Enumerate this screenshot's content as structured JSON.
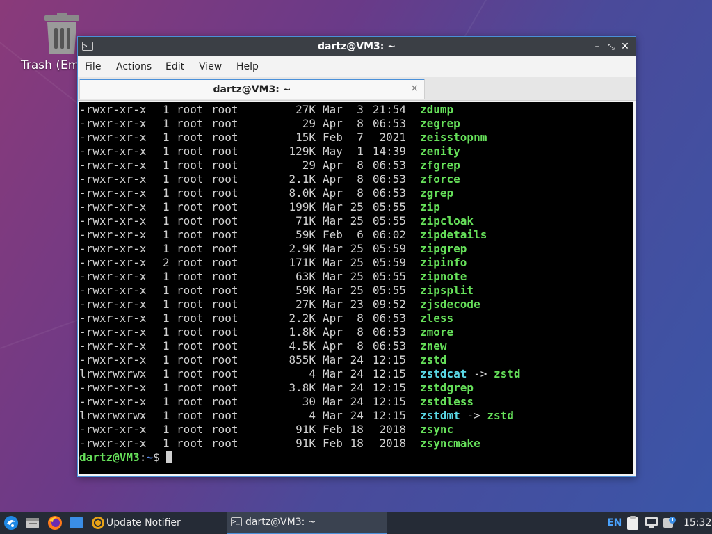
{
  "desktop": {
    "trash_label": "Trash (Em"
  },
  "window": {
    "title": "dartz@VM3: ~",
    "controls": [
      "minimize",
      "maximize",
      "close"
    ],
    "menu": [
      "File",
      "Actions",
      "Edit",
      "View",
      "Help"
    ],
    "tab": {
      "label": "dartz@VM3: ~",
      "close": "×"
    }
  },
  "terminal": {
    "rows": [
      {
        "perm": "-rwxr-xr-x",
        "links": "1",
        "owner": "root",
        "group": "root",
        "size": "27K",
        "month": "Mar",
        "day": "3",
        "time": "21:54",
        "name": "zdump"
      },
      {
        "perm": "-rwxr-xr-x",
        "links": "1",
        "owner": "root",
        "group": "root",
        "size": "29",
        "month": "Apr",
        "day": "8",
        "time": "06:53",
        "name": "zegrep"
      },
      {
        "perm": "-rwxr-xr-x",
        "links": "1",
        "owner": "root",
        "group": "root",
        "size": "15K",
        "month": "Feb",
        "day": "7",
        "time": "2021",
        "name": "zeisstopnm"
      },
      {
        "perm": "-rwxr-xr-x",
        "links": "1",
        "owner": "root",
        "group": "root",
        "size": "129K",
        "month": "May",
        "day": "1",
        "time": "14:39",
        "name": "zenity"
      },
      {
        "perm": "-rwxr-xr-x",
        "links": "1",
        "owner": "root",
        "group": "root",
        "size": "29",
        "month": "Apr",
        "day": "8",
        "time": "06:53",
        "name": "zfgrep"
      },
      {
        "perm": "-rwxr-xr-x",
        "links": "1",
        "owner": "root",
        "group": "root",
        "size": "2.1K",
        "month": "Apr",
        "day": "8",
        "time": "06:53",
        "name": "zforce"
      },
      {
        "perm": "-rwxr-xr-x",
        "links": "1",
        "owner": "root",
        "group": "root",
        "size": "8.0K",
        "month": "Apr",
        "day": "8",
        "time": "06:53",
        "name": "zgrep"
      },
      {
        "perm": "-rwxr-xr-x",
        "links": "1",
        "owner": "root",
        "group": "root",
        "size": "199K",
        "month": "Mar",
        "day": "25",
        "time": "05:55",
        "name": "zip"
      },
      {
        "perm": "-rwxr-xr-x",
        "links": "1",
        "owner": "root",
        "group": "root",
        "size": "71K",
        "month": "Mar",
        "day": "25",
        "time": "05:55",
        "name": "zipcloak"
      },
      {
        "perm": "-rwxr-xr-x",
        "links": "1",
        "owner": "root",
        "group": "root",
        "size": "59K",
        "month": "Feb",
        "day": "6",
        "time": "06:02",
        "name": "zipdetails"
      },
      {
        "perm": "-rwxr-xr-x",
        "links": "1",
        "owner": "root",
        "group": "root",
        "size": "2.9K",
        "month": "Mar",
        "day": "25",
        "time": "05:59",
        "name": "zipgrep"
      },
      {
        "perm": "-rwxr-xr-x",
        "links": "2",
        "owner": "root",
        "group": "root",
        "size": "171K",
        "month": "Mar",
        "day": "25",
        "time": "05:59",
        "name": "zipinfo"
      },
      {
        "perm": "-rwxr-xr-x",
        "links": "1",
        "owner": "root",
        "group": "root",
        "size": "63K",
        "month": "Mar",
        "day": "25",
        "time": "05:55",
        "name": "zipnote"
      },
      {
        "perm": "-rwxr-xr-x",
        "links": "1",
        "owner": "root",
        "group": "root",
        "size": "59K",
        "month": "Mar",
        "day": "25",
        "time": "05:55",
        "name": "zipsplit"
      },
      {
        "perm": "-rwxr-xr-x",
        "links": "1",
        "owner": "root",
        "group": "root",
        "size": "27K",
        "month": "Mar",
        "day": "23",
        "time": "09:52",
        "name": "zjsdecode"
      },
      {
        "perm": "-rwxr-xr-x",
        "links": "1",
        "owner": "root",
        "group": "root",
        "size": "2.2K",
        "month": "Apr",
        "day": "8",
        "time": "06:53",
        "name": "zless"
      },
      {
        "perm": "-rwxr-xr-x",
        "links": "1",
        "owner": "root",
        "group": "root",
        "size": "1.8K",
        "month": "Apr",
        "day": "8",
        "time": "06:53",
        "name": "zmore"
      },
      {
        "perm": "-rwxr-xr-x",
        "links": "1",
        "owner": "root",
        "group": "root",
        "size": "4.5K",
        "month": "Apr",
        "day": "8",
        "time": "06:53",
        "name": "znew"
      },
      {
        "perm": "-rwxr-xr-x",
        "links": "1",
        "owner": "root",
        "group": "root",
        "size": "855K",
        "month": "Mar",
        "day": "24",
        "time": "12:15",
        "name": "zstd"
      },
      {
        "perm": "lrwxrwxrwx",
        "links": "1",
        "owner": "root",
        "group": "root",
        "size": "4",
        "month": "Mar",
        "day": "24",
        "time": "12:15",
        "name": "zstdcat",
        "arrow": "->",
        "target": "zstd"
      },
      {
        "perm": "-rwxr-xr-x",
        "links": "1",
        "owner": "root",
        "group": "root",
        "size": "3.8K",
        "month": "Mar",
        "day": "24",
        "time": "12:15",
        "name": "zstdgrep"
      },
      {
        "perm": "-rwxr-xr-x",
        "links": "1",
        "owner": "root",
        "group": "root",
        "size": "30",
        "month": "Mar",
        "day": "24",
        "time": "12:15",
        "name": "zstdless"
      },
      {
        "perm": "lrwxrwxrwx",
        "links": "1",
        "owner": "root",
        "group": "root",
        "size": "4",
        "month": "Mar",
        "day": "24",
        "time": "12:15",
        "name": "zstdmt",
        "arrow": "->",
        "target": "zstd"
      },
      {
        "perm": "-rwxr-xr-x",
        "links": "1",
        "owner": "root",
        "group": "root",
        "size": "91K",
        "month": "Feb",
        "day": "18",
        "time": "2018",
        "name": "zsync"
      },
      {
        "perm": "-rwxr-xr-x",
        "links": "1",
        "owner": "root",
        "group": "root",
        "size": "91K",
        "month": "Feb",
        "day": "18",
        "time": "2018",
        "name": "zsyncmake"
      }
    ],
    "prompt": {
      "user_host": "dartz@VM3",
      "colon": ":",
      "path": "~",
      "dollar": "$"
    }
  },
  "taskbar": {
    "start_icon": "lubuntu-start-icon",
    "launchers": [
      "file-manager-icon",
      "firefox-icon",
      "show-desktop-icon"
    ],
    "tasks": [
      {
        "icon": "update-notifier-icon",
        "label": "Update Notifier"
      },
      {
        "icon": "terminal-icon",
        "label": "dartz@VM3: ~"
      }
    ],
    "tray": {
      "language": "EN",
      "icons": [
        "clipboard-icon",
        "network-icon",
        "notification-icon"
      ],
      "clock": "15:32"
    }
  },
  "colors": {
    "window_border": "#4a90d9",
    "titlebar": "#3b3f45",
    "terminal_bg": "#000000",
    "exec_green": "#66e05a",
    "link_cyan": "#5ad8e6",
    "prompt_blue": "#5a8cf0",
    "taskbar": "#252b36"
  }
}
